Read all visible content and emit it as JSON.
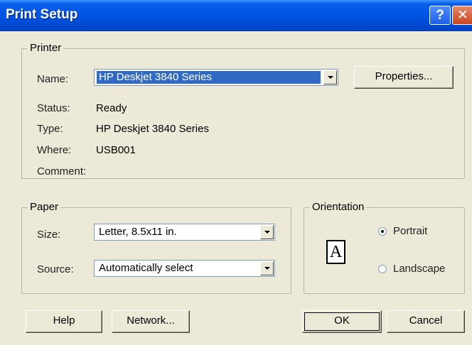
{
  "window": {
    "title": "Print Setup",
    "help_glyph": "?",
    "close_glyph": "✕"
  },
  "printer": {
    "group_label": "Printer",
    "name_label": "Name:",
    "name_value": "HP Deskjet 3840 Series",
    "properties_button": "Properties...",
    "status_label": "Status:",
    "status_value": "Ready",
    "type_label": "Type:",
    "type_value": "HP Deskjet 3840 Series",
    "where_label": "Where:",
    "where_value": "USB001",
    "comment_label": "Comment:",
    "comment_value": ""
  },
  "paper": {
    "group_label": "Paper",
    "size_label": "Size:",
    "size_value": "Letter, 8.5x11 in.",
    "source_label": "Source:",
    "source_value": "Automatically select"
  },
  "orientation": {
    "group_label": "Orientation",
    "page_icon_letter": "A",
    "portrait_label": "Portrait",
    "landscape_label": "Landscape",
    "selected": "Portrait"
  },
  "buttons": {
    "help": "Help",
    "network": "Network...",
    "ok": "OK",
    "cancel": "Cancel"
  }
}
